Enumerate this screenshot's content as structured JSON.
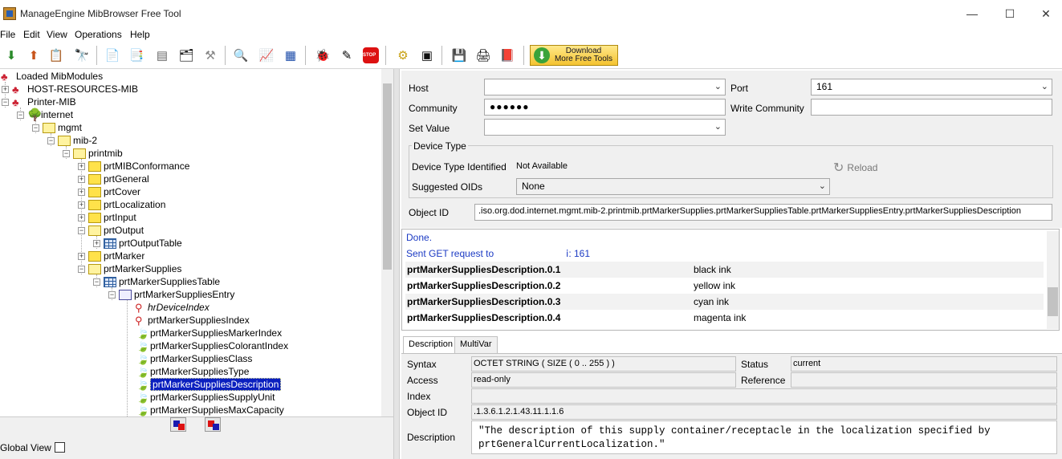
{
  "window": {
    "title": "ManageEngine MibBrowser Free Tool",
    "minimize": "—",
    "maximize": "☐",
    "close": "✕"
  },
  "menu": [
    "File",
    "Edit",
    "View",
    "Operations",
    "Help"
  ],
  "download": {
    "line1": "Download",
    "line2": "More Free Tools"
  },
  "tree": {
    "root": "Loaded MibModules",
    "nodes": [
      "HOST-RESOURCES-MIB",
      "Printer-MIB",
      "internet",
      "mgmt",
      "mib-2",
      "printmib",
      "prtMIBConformance",
      "prtGeneral",
      "prtCover",
      "prtLocalization",
      "prtInput",
      "prtOutput",
      "prtOutputTable",
      "prtMarker",
      "prtMarkerSupplies",
      "prtMarkerSuppliesTable",
      "prtMarkerSuppliesEntry",
      "hrDeviceIndex",
      "prtMarkerSuppliesIndex",
      "prtMarkerSuppliesMarkerIndex",
      "prtMarkerSuppliesColorantIndex",
      "prtMarkerSuppliesClass",
      "prtMarkerSuppliesType",
      "prtMarkerSuppliesDescription",
      "prtMarkerSuppliesSupplyUnit",
      "prtMarkerSuppliesMaxCapacity"
    ],
    "selected": "prtMarkerSuppliesDescription"
  },
  "footer": {
    "global_view": "Global View"
  },
  "form": {
    "host_label": "Host",
    "host_value": "",
    "port_label": "Port",
    "port_value": "161",
    "community_label": "Community",
    "community_value": "●●●●●●",
    "write_community_label": "Write Community",
    "write_community_value": "",
    "set_value_label": "Set Value",
    "set_value": ""
  },
  "device_type": {
    "title": "Device Type",
    "identified_label": "Device Type Identified",
    "identified_value": "Not Available",
    "reload": "Reload",
    "suggested_label": "Suggested OIDs",
    "suggested_value": "None"
  },
  "object_id": {
    "label": "Object ID",
    "value": ".iso.org.dod.internet.mgmt.mib-2.printmib.prtMarkerSupplies.prtMarkerSuppliesTable.prtMarkerSuppliesEntry.prtMarkerSuppliesDescription"
  },
  "results": {
    "status": "Done.",
    "sent": "Sent GET request to",
    "sent_port": "ⅰ: 161",
    "rows": [
      {
        "name": "prtMarkerSuppliesDescription.0.1",
        "value": "black ink"
      },
      {
        "name": "prtMarkerSuppliesDescription.0.2",
        "value": "yellow ink"
      },
      {
        "name": "prtMarkerSuppliesDescription.0.3",
        "value": "cyan ink"
      },
      {
        "name": "prtMarkerSuppliesDescription.0.4",
        "value": "magenta ink"
      }
    ]
  },
  "tabs": [
    "Description",
    "MultiVar"
  ],
  "details": {
    "syntax_label": "Syntax",
    "syntax": "OCTET STRING  ( SIZE ( 0 .. 255 ) )",
    "status_label": "Status",
    "status": "current",
    "access_label": "Access",
    "access": "read-only",
    "reference_label": "Reference",
    "reference": "",
    "index_label": "Index",
    "index": "",
    "oid_label": "Object ID",
    "oid": ".1.3.6.1.2.1.43.11.1.1.6",
    "desc_label": "Description",
    "description": "\"The description of this supply container/receptacle in the localization specified by prtGeneralCurrentLocalization.\""
  }
}
